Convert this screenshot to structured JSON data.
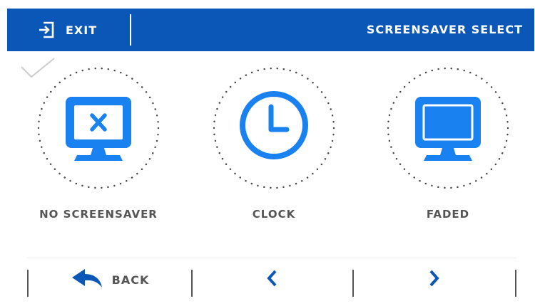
{
  "header": {
    "exit_label": "EXIT",
    "title": "SCREENSAVER SELECT",
    "background_color": "#0a57b8"
  },
  "options": [
    {
      "label": "NO SCREENSAVER",
      "icon": "monitor-x-icon",
      "selected": true
    },
    {
      "label": "CLOCK",
      "icon": "clock-icon",
      "selected": false
    },
    {
      "label": "FADED",
      "icon": "monitor-faded-icon",
      "selected": false
    }
  ],
  "bottom_bar": {
    "back_label": "BACK",
    "prev_icon": "chevron-left-icon",
    "next_icon": "chevron-right-icon"
  },
  "colors": {
    "accent": "#1a82f0",
    "text_gray": "#555555"
  }
}
